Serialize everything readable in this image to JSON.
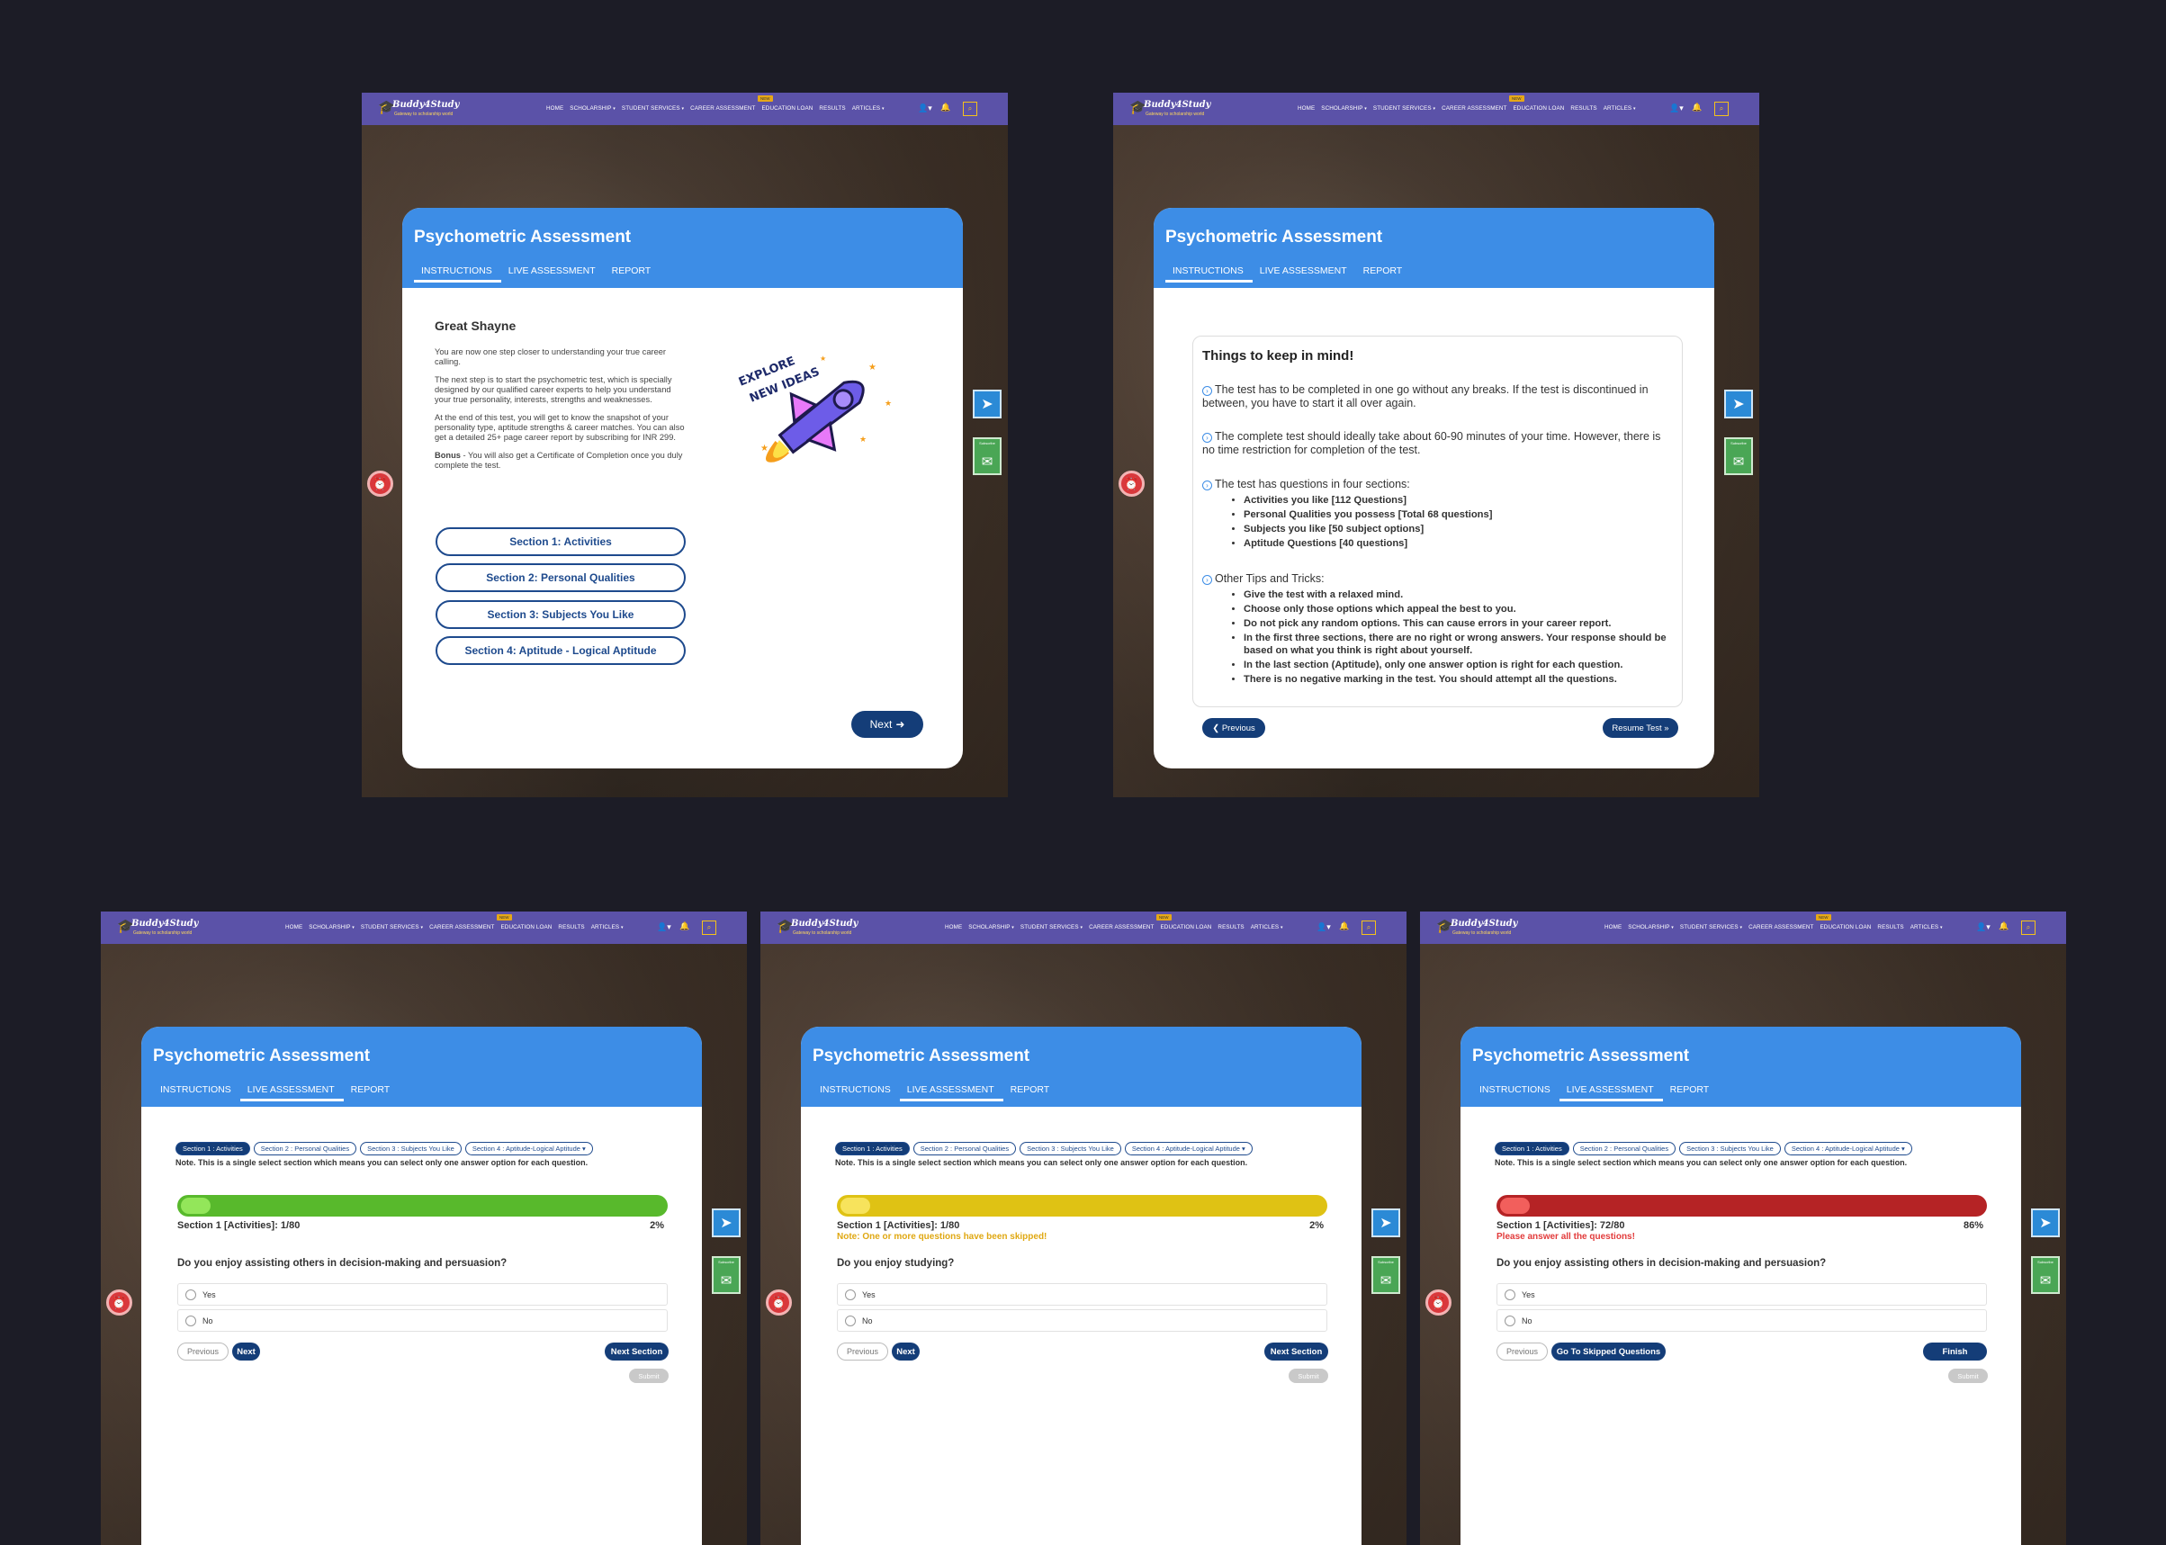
{
  "nav": {
    "brand": "Buddy4Study",
    "tagline": "Gateway to scholarship world",
    "items": [
      "HOME",
      "SCHOLARSHIP",
      "STUDENT SERVICES",
      "CAREER ASSESSMENT",
      "EDUCATION LOAN",
      "RESULTS",
      "ARTICLES"
    ],
    "new_badge": "NEW"
  },
  "card": {
    "title": "Psychometric Assessment",
    "tabs": [
      "INSTRUCTIONS",
      "LIVE ASSESSMENT",
      "REPORT"
    ]
  },
  "panel1": {
    "greeting": "Great Shayne",
    "para1": "You are now one step closer to understanding your true career calling.",
    "para2": "The next step is to start the psychometric test, which is specially designed by our qualified career experts to help you understand your true personality, interests, strengths and weaknesses.",
    "para3": "At the end of this test, you will get to know the snapshot of your personality type, aptitude strengths & career matches. You can also get a detailed 25+ page career report by subscribing for INR 299.",
    "bonus_label": "Bonus",
    "bonus_text": " - You will also get a Certificate of Completion once you duly complete the test.",
    "sections": [
      "Section 1: Activities",
      "Section 2: Personal Qualities",
      "Section 3: Subjects You Like",
      "Section 4: Aptitude - Logical Aptitude"
    ],
    "rocket_text_1": "EXPLORE",
    "rocket_text_2": "NEW IDEAS",
    "next": "Next"
  },
  "panel2": {
    "heading": "Things to keep in mind!",
    "point1": "The test has to be completed in one go without any breaks. If the test is discontinued in between, you have to start it all over again.",
    "point2": "The complete test should ideally take about 60-90 minutes of your time. However, there is no time restriction for completion of the test.",
    "point3": "The test has questions in four sections:",
    "sections": [
      "Activities you like [112 Questions]",
      "Personal Qualities you possess [Total 68 questions]",
      "Subjects you like [50 subject options]",
      "Aptitude Questions [40 questions]"
    ],
    "point4": "Other Tips and Tricks:",
    "tips": [
      "Give the test with a relaxed mind.",
      "Choose only those options which appeal the best to you.",
      "Do not pick any random options. This can cause errors in your career report.",
      "In the first three sections, there are no right or wrong answers. Your response should be based on what you think is right about yourself.",
      "In the last section (Aptitude), only one answer option is right for each question.",
      "There is no negative marking in the test. You should attempt all the questions."
    ],
    "previous": "Previous",
    "resume": "Resume Test"
  },
  "live": {
    "chips": [
      "Section 1 : Activities",
      "Section 2 : Personal Qualities",
      "Section 3 : Subjects You Like",
      "Section 4 : Aptitude-Logical Aptitude"
    ],
    "note": "Note. This is a single select section which means you can select only one answer option for each question.",
    "options": [
      "Yes",
      "No"
    ],
    "previous": "Previous",
    "next": "Next",
    "submit": "Submit"
  },
  "panel3": {
    "progress_label": "Section 1 [Activities]: 1/80",
    "progress": 2,
    "progress_text": "2%",
    "question": "Do you enjoy assisting others in decision-making and persuasion?",
    "action": "Next Section",
    "bar_color": "#58b92c",
    "knob_color": "#93e65a"
  },
  "panel4": {
    "progress_label": "Section 1 [Activities]: 1/80",
    "progress": 2,
    "progress_text": "2%",
    "warning": "Note: One or more questions have been skipped!",
    "question": "Do you enjoy studying?",
    "action": "Next Section",
    "bar_color": "#dfc214",
    "knob_color": "#f7e35c",
    "warn_color": "#e0a812"
  },
  "panel5": {
    "progress_label": "Section 1 [Activities]: 72/80",
    "progress": 86,
    "progress_text": "86%",
    "warning": "Please answer all the questions!",
    "question": "Do you enjoy assisting others in decision-making and persuasion?",
    "skipped": "Go To Skipped Questions",
    "action": "Finish",
    "bar_color": "#b52325",
    "knob_color": "#f25f5c",
    "warn_color": "#e23b3b"
  },
  "colors": {
    "nav": "#5b52a8",
    "card_header": "#3d8de6",
    "primary_button": "#143d78",
    "page_bg": "#1c1c26"
  }
}
